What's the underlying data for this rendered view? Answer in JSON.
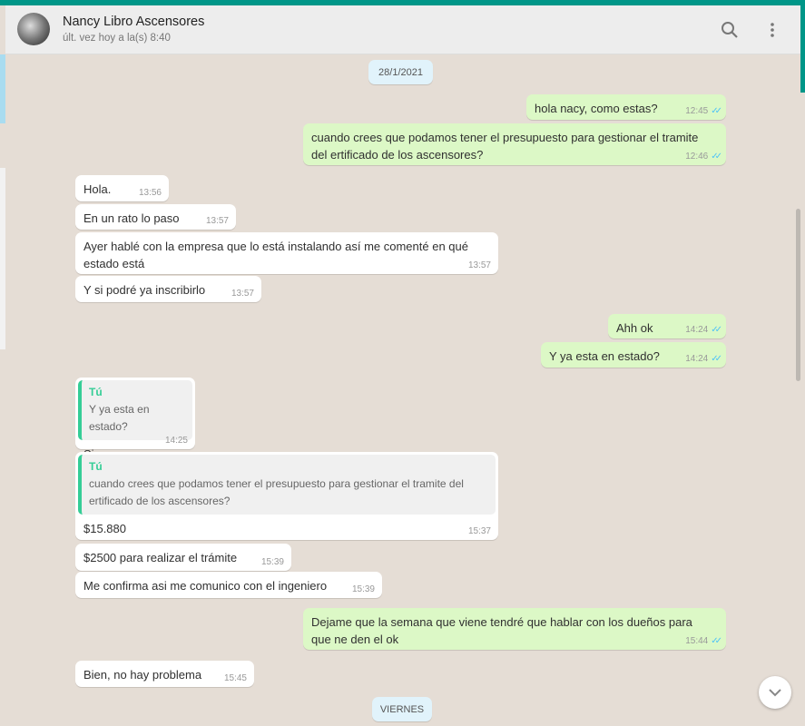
{
  "header": {
    "name": "Nancy Libro Ascensores",
    "status": "últ. vez hoy a la(s) 8:40"
  },
  "dates": [
    "28/1/2021",
    "VIERNES"
  ],
  "messages": [
    {
      "text": "hola nacy, como estas?",
      "time": "12:45"
    },
    {
      "text": "cuando crees que podamos tener el presupuesto para gestionar el tramite del ertificado de los ascensores?",
      "time": "12:46"
    },
    {
      "text": "Hola.",
      "time": "13:56"
    },
    {
      "text": "En un rato lo paso",
      "time": "13:57"
    },
    {
      "text": "Ayer hablé con la empresa que lo está instalando así me comenté en qué estado está",
      "time": "13:57"
    },
    {
      "text": "Y si podré ya inscribirlo",
      "time": "13:57"
    },
    {
      "text": "Ahh ok",
      "time": "14:24"
    },
    {
      "text": "Y ya esta en estado?",
      "time": "14:24"
    },
    {
      "quote_author": "Tú",
      "quote": "Y ya esta en estado?",
      "text": "Si",
      "time": "14:25"
    },
    {
      "quote_author": "Tú",
      "quote": "cuando crees que podamos tener el presupuesto para gestionar el tramite del ertificado de los ascensores?",
      "text": "$15.880",
      "time": "15:37"
    },
    {
      "text": "$2500 para realizar el trámite",
      "time": "15:39"
    },
    {
      "text": "Me confirma asi me comunico con el ingeniero",
      "time": "15:39"
    },
    {
      "text": "Dejame que la semana que viene tendré que hablar con los dueños para que ne den el ok",
      "time": "15:44"
    },
    {
      "text": "Bien, no hay problema",
      "time": "15:45"
    }
  ]
}
